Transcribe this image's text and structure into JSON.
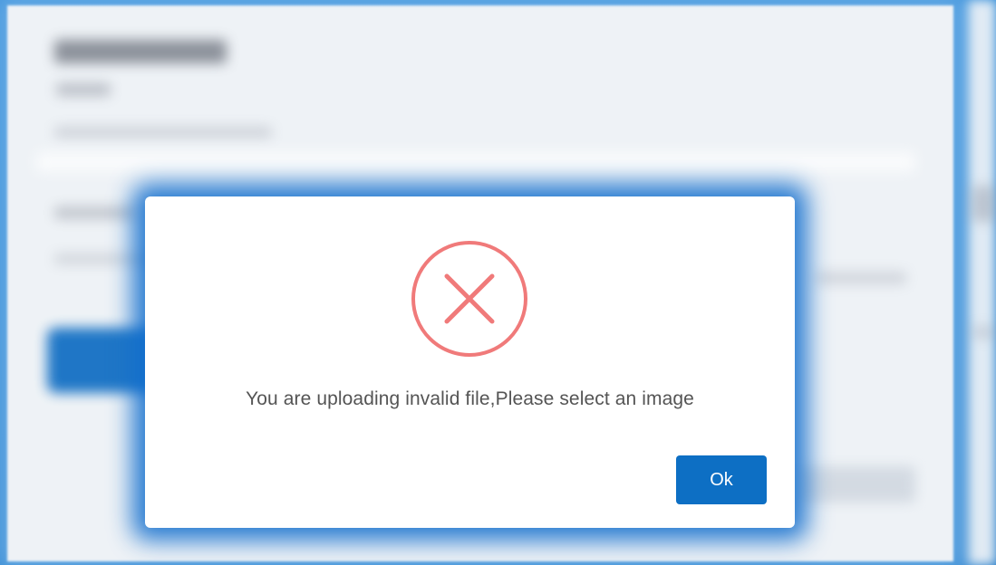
{
  "dialog": {
    "icon": "error-x-circle-icon",
    "message": "You are uploading invalid file,Please select an image",
    "ok_label": "Ok"
  },
  "colors": {
    "accent": "#0d6fc4",
    "error": "#f07a7a",
    "backdrop": "#1f7fd0"
  }
}
